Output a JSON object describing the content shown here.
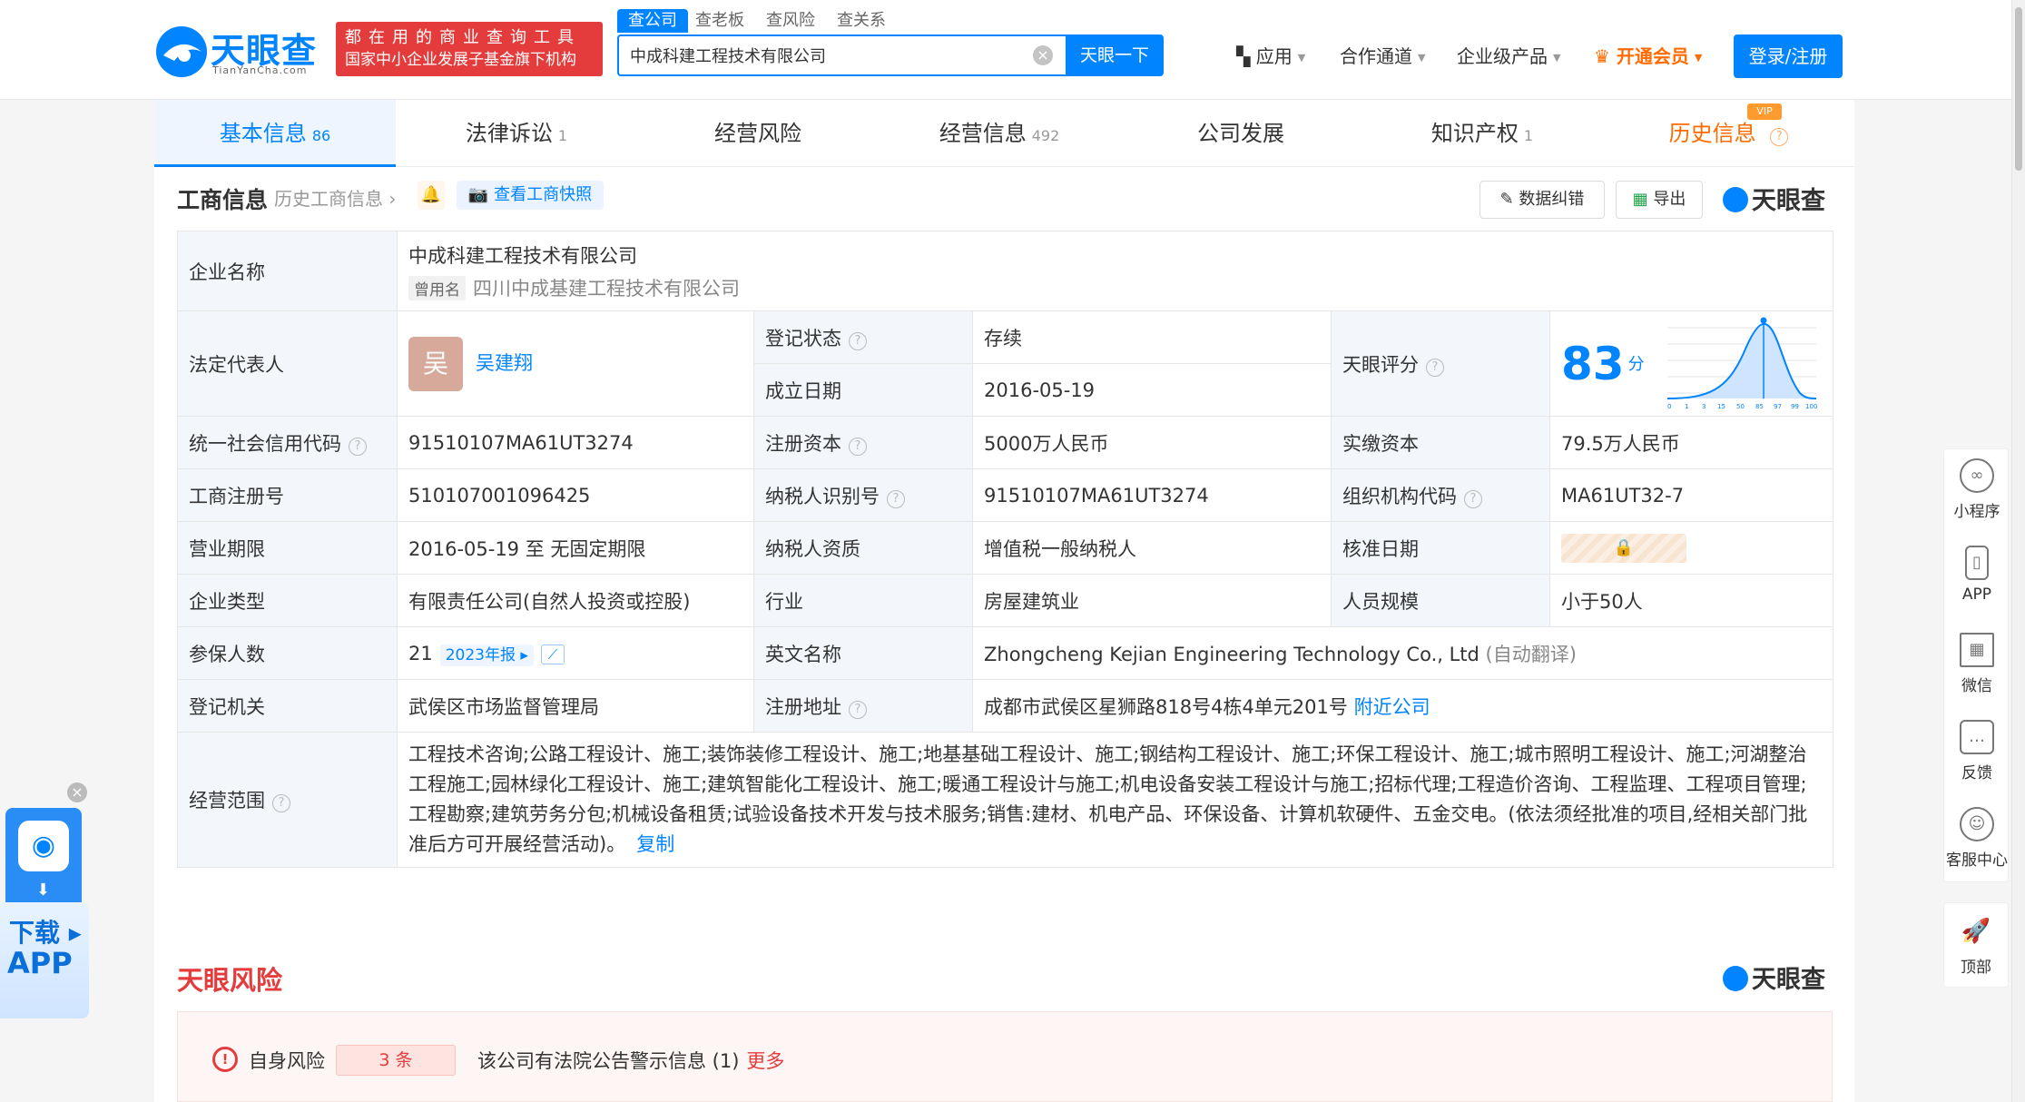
{
  "header": {
    "logo_text": "天眼查",
    "logo_sub": "TianYanCha.com",
    "slogan_line1": "都在用的商业查询工具",
    "slogan_line2": "国家中小企业发展子基金旗下机构",
    "search_tabs": [
      "查公司",
      "查老板",
      "查风险",
      "查关系"
    ],
    "search_value": "中成科建工程技术有限公司",
    "search_button": "天眼一下",
    "nav": {
      "apps": "应用",
      "cooperation": "合作通道",
      "enterprise": "企业级产品",
      "vip": "开通会员"
    },
    "login": "登录/注册"
  },
  "tabs": [
    {
      "label": "基本信息",
      "count": "86"
    },
    {
      "label": "法律诉讼",
      "count": "1"
    },
    {
      "label": "经营风险",
      "count": ""
    },
    {
      "label": "经营信息",
      "count": "492"
    },
    {
      "label": "公司发展",
      "count": ""
    },
    {
      "label": "知识产权",
      "count": "1"
    },
    {
      "label": "历史信息",
      "count": ""
    }
  ],
  "vip_badge": "VIP",
  "section": {
    "title": "工商信息",
    "history_link": "历史工商信息",
    "snapshot_button": "查看工商快照",
    "correct_button": "数据纠错",
    "export_button": "导出",
    "brand": "天眼查"
  },
  "company": {
    "name_label": "企业名称",
    "name": "中成科建工程技术有限公司",
    "former_tag": "曾用名",
    "former_name": "四川中成基建工程技术有限公司",
    "rep_label": "法定代表人",
    "rep_avatar": "吴",
    "rep_name": "吴建翔",
    "status_label": "登记状态",
    "status": "存续",
    "est_label": "成立日期",
    "est_date": "2016-05-19",
    "score_label": "天眼评分",
    "score": "83",
    "score_unit": "分",
    "credit_label": "统一社会信用代码",
    "credit_code": "91510107MA61UT3274",
    "reg_cap_label": "注册资本",
    "reg_cap": "5000万人民币",
    "paid_cap_label": "实缴资本",
    "paid_cap": "79.5万人民币",
    "reg_no_label": "工商注册号",
    "reg_no": "510107001096425",
    "taxpayer_id_label": "纳税人识别号",
    "taxpayer_id": "91510107MA61UT3274",
    "org_code_label": "组织机构代码",
    "org_code": "MA61UT32-7",
    "term_label": "营业期限",
    "term": "2016-05-19 至 无固定期限",
    "tax_qual_label": "纳税人资质",
    "tax_qual": "增值税一般纳税人",
    "approve_label": "核准日期",
    "type_label": "企业类型",
    "type": "有限责任公司(自然人投资或控股)",
    "industry_label": "行业",
    "industry": "房屋建筑业",
    "staff_label": "人员规模",
    "staff": "小于50人",
    "insured_label": "参保人数",
    "insured": "21",
    "insured_year": "2023年报",
    "en_label": "英文名称",
    "en_name": "Zhongcheng Kejian Engineering Technology Co., Ltd",
    "en_note": "(自动翻译)",
    "authority_label": "登记机关",
    "authority": "武侯区市场监督管理局",
    "address_label": "注册地址",
    "address": "成都市武侯区星狮路818号4栋4单元201号",
    "nearby": "附近公司",
    "scope_label": "经营范围",
    "scope": "工程技术咨询;公路工程设计、施工;装饰装修工程设计、施工;地基基础工程设计、施工;钢结构工程设计、施工;环保工程设计、施工;城市照明工程设计、施工;河湖整治工程施工;园林绿化工程设计、施工;建筑智能化工程设计、施工;暖通工程设计与施工;机电设备安装工程设计与施工;招标代理;工程造价咨询、工程监理、工程项目管理;工程勘察;建筑劳务分包;机械设备租赁;试验设备技术开发与技术服务;销售:建材、机电产品、环保设备、计算机软硬件、五金交电。(依法须经批准的项目,经相关部门批准后方可开展经营活动)。",
    "copy": "复制"
  },
  "score_chart_ticks": [
    "0",
    "1",
    "3",
    "15",
    "50",
    "85",
    "97",
    "99",
    "100"
  ],
  "sidebar": [
    {
      "label": "小程序",
      "icon": "mini-program-icon"
    },
    {
      "label": "APP",
      "icon": "phone-icon"
    },
    {
      "label": "微信",
      "icon": "qrcode-icon"
    },
    {
      "label": "反馈",
      "icon": "feedback-icon"
    },
    {
      "label": "客服中心",
      "icon": "customer-service-icon"
    }
  ],
  "back_top": "顶部",
  "download": {
    "line1": "下载",
    "line2": "APP"
  },
  "risk": {
    "title": "天眼风险",
    "brand": "天眼查",
    "self_label": "自身风险",
    "count": "3 条",
    "desc": "该公司有法院公告警示信息 (1)",
    "more": "更多"
  }
}
